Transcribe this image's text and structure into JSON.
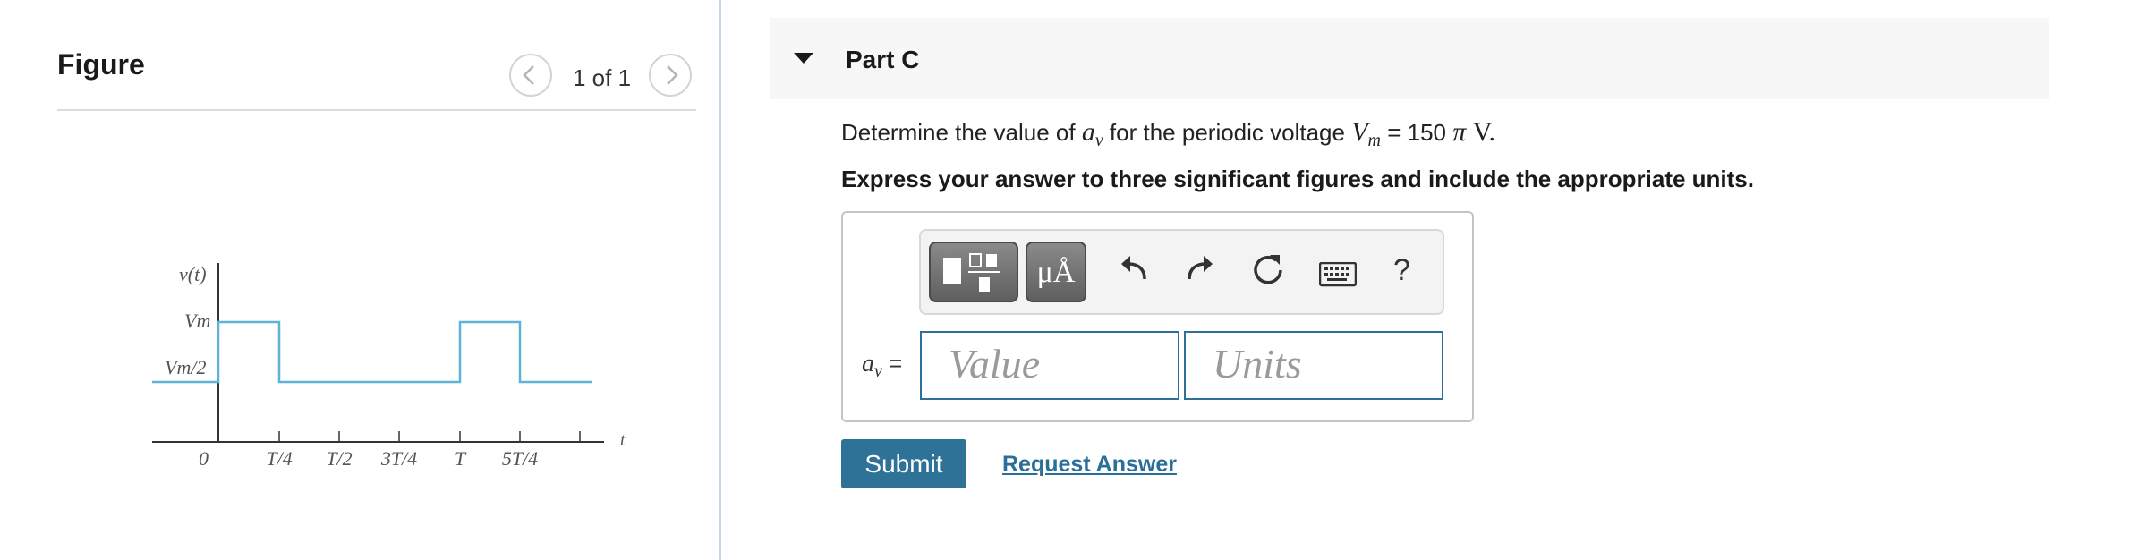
{
  "figure_pane": {
    "title": "Figure",
    "pager": "1 of 1",
    "graph": {
      "y_axis_label": "v(t)",
      "level_high_label": "Vm",
      "level_low_label": "Vm/2",
      "x_axis_label": "t",
      "origin_label": "0",
      "tick_labels": [
        "T/4",
        "T/2",
        "3T/4",
        "T",
        "5T/4"
      ]
    }
  },
  "part": {
    "title": "Part C",
    "question_prefix": "Determine the value of ",
    "question_var": "a",
    "question_var_sub": "v",
    "question_mid": " for the periodic voltage ",
    "question_vm": "V",
    "question_vm_sub": "m",
    "question_eq": " = 150 ",
    "question_pi": "π",
    "question_unit": " V.",
    "instructions": "Express your answer to three significant figures and include the appropriate units."
  },
  "toolbar": {
    "templates_icon": "templates-icon",
    "units_label": "μÅ",
    "undo_icon": "undo-icon",
    "redo_icon": "redo-icon",
    "reset_icon": "reset-icon",
    "keyboard_icon": "keyboard-icon",
    "help_label": "?"
  },
  "answer": {
    "label_var": "a",
    "label_sub": "v",
    "label_eq": " =",
    "value_placeholder": "Value",
    "units_placeholder": "Units"
  },
  "actions": {
    "submit_label": "Submit",
    "request_label": "Request Answer"
  },
  "colors": {
    "accent": "#2e7297",
    "waveform": "#5fb4d6",
    "field_border": "#2f6d9a"
  }
}
